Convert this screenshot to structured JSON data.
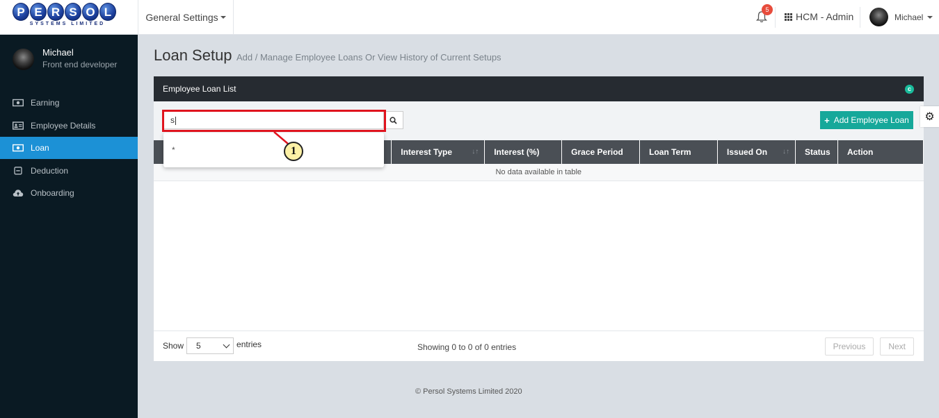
{
  "brand": {
    "logo_letters": [
      "P",
      "E",
      "R",
      "S",
      "O",
      "L"
    ],
    "logo_sub": "SYSTEMS LIMITED"
  },
  "topbar": {
    "menu_label": "General Settings",
    "notification_count": "5",
    "app_label": "HCM - Admin",
    "user_name": "Michael"
  },
  "sidebar": {
    "user_name": "Michael",
    "user_role": "Front end developer",
    "items": [
      {
        "label": "Earning",
        "icon": "money-icon",
        "active": false
      },
      {
        "label": "Employee Details",
        "icon": "id-card-icon",
        "active": false
      },
      {
        "label": "Loan",
        "icon": "money-icon",
        "active": true
      },
      {
        "label": "Deduction",
        "icon": "minus-square-icon",
        "active": false
      },
      {
        "label": "Onboarding",
        "icon": "cloud-upload-icon",
        "active": false
      }
    ]
  },
  "page": {
    "title": "Loan Setup",
    "subtitle": "Add / Manage Employee Loans Or View History of Current Setups"
  },
  "panel": {
    "title": "Employee Loan List",
    "add_button": "Add Employee Loan"
  },
  "search": {
    "value": "s",
    "suggestion": "*"
  },
  "callout": {
    "number": "1"
  },
  "table": {
    "columns": [
      {
        "label": "",
        "sortable": false
      },
      {
        "label": "",
        "sortable": false
      },
      {
        "label": "",
        "sortable": false
      },
      {
        "label": "Interest Type",
        "sortable": true
      },
      {
        "label": "Interest (%)",
        "sortable": false
      },
      {
        "label": "Grace Period",
        "sortable": false
      },
      {
        "label": "Loan Term",
        "sortable": false
      },
      {
        "label": "Issued On",
        "sortable": true
      },
      {
        "label": "Status",
        "sortable": false
      },
      {
        "label": "Action",
        "sortable": false
      }
    ],
    "empty_text": "No data available in table"
  },
  "footer": {
    "show_label": "Show",
    "entries_value": "5",
    "entries_label": "entries",
    "info": "Showing 0 to 0 of 0 entries",
    "previous": "Previous",
    "next": "Next"
  },
  "copyright": "© Persol Systems Limited 2020",
  "colors": {
    "sidebar_bg": "#0a1a23",
    "active": "#1c91d6",
    "add_button": "#16a89a",
    "highlight": "#e0141e",
    "badge": "#e74c3c"
  }
}
